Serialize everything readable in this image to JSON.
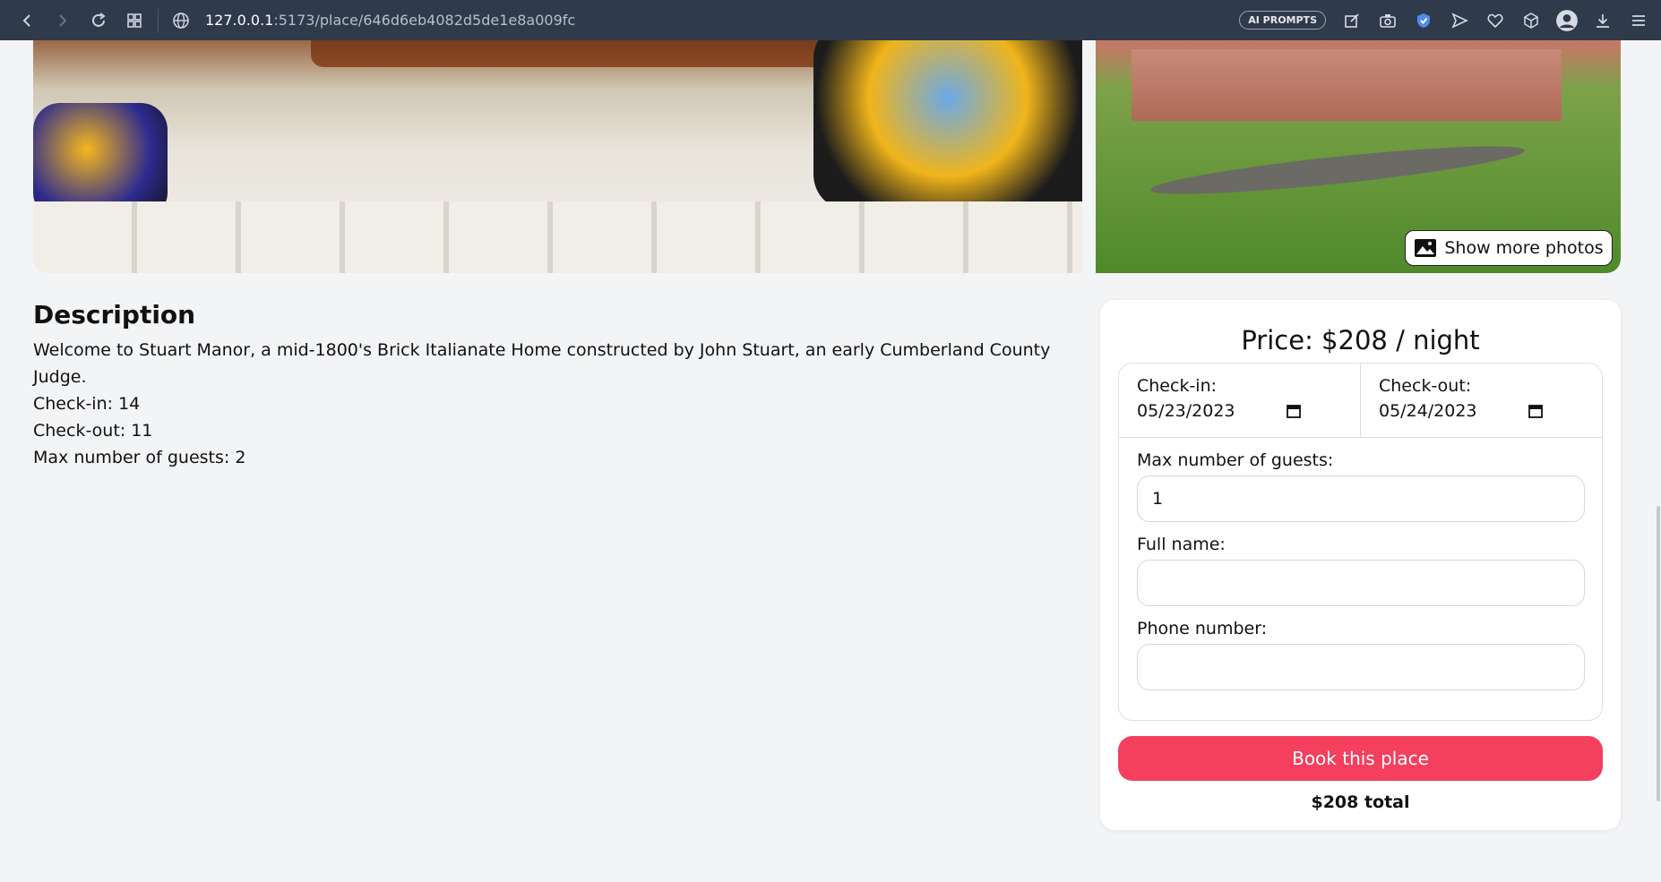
{
  "browser": {
    "url_host": "127.0.0.1",
    "url_path": ":5173/place/646d6eb4082d5de1e8a009fc",
    "ai_prompts_label": "AI PROMPTS",
    "icons": [
      "back-icon",
      "forward-icon",
      "reload-icon",
      "tabs-grid-icon",
      "globe-icon",
      "edit-icon",
      "camera-icon",
      "shield-icon",
      "send-icon",
      "heart-icon",
      "cube-icon",
      "profile-icon",
      "download-icon",
      "menu-icon"
    ]
  },
  "gallery": {
    "show_more_label": "Show more photos"
  },
  "description": {
    "heading": "Description",
    "text": "Welcome to Stuart Manor, a mid-1800's Brick Italianate Home constructed by John Stuart, an early Cumberland County Judge.",
    "check_in": "Check-in: 14",
    "check_out": "Check-out: 11",
    "max_guests": "Max number of guests: 2"
  },
  "booking": {
    "price": "Price: $208 / night",
    "check_in_label": "Check-in:",
    "check_in_value": "05/23/2023",
    "check_out_label": "Check-out:",
    "check_out_value": "05/24/2023",
    "guests_label": "Max number of guests:",
    "guests_value": "1",
    "name_label": "Full name:",
    "name_value": "",
    "phone_label": "Phone number:",
    "phone_value": "",
    "book_label": "Book this place",
    "total": "$208 total"
  },
  "colors": {
    "accent": "#f43f5e",
    "chrome_bg": "#2f3a4a",
    "page_bg": "#f3f4f6"
  }
}
